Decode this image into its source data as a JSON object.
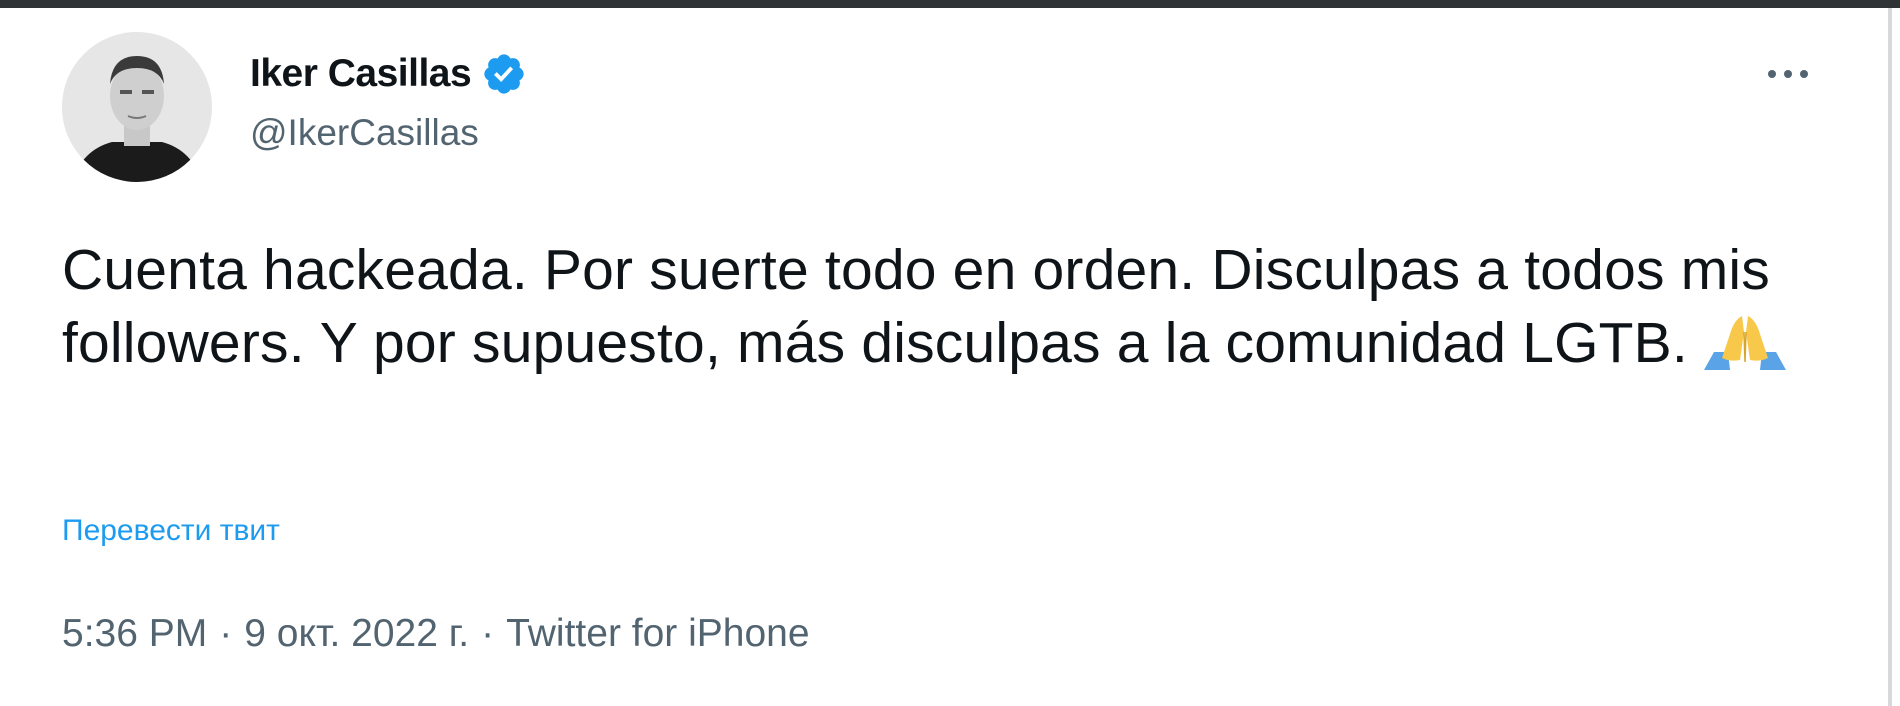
{
  "author": {
    "display_name": "Iker Casillas",
    "handle": "@IkerCasillas",
    "verified": true,
    "verified_color": "#1d9bf0"
  },
  "tweet": {
    "text": "Cuenta hackeada. Por suerte todo en orden. Disculpas a todos mis followers. Y por supuesto, más disculpas a la comunidad LGTB.",
    "emoji": "folded-hands-icon",
    "translate_label": "Перевести твит",
    "time": "5:36 PM",
    "separator": "·",
    "date": "9 окт. 2022 г.",
    "source": "Twitter for iPhone"
  },
  "icons": {
    "more": "more-options-icon",
    "verified": "verified-badge-icon"
  },
  "colors": {
    "text": "#0f1419",
    "secondary": "#536471",
    "link": "#1d9bf0"
  }
}
